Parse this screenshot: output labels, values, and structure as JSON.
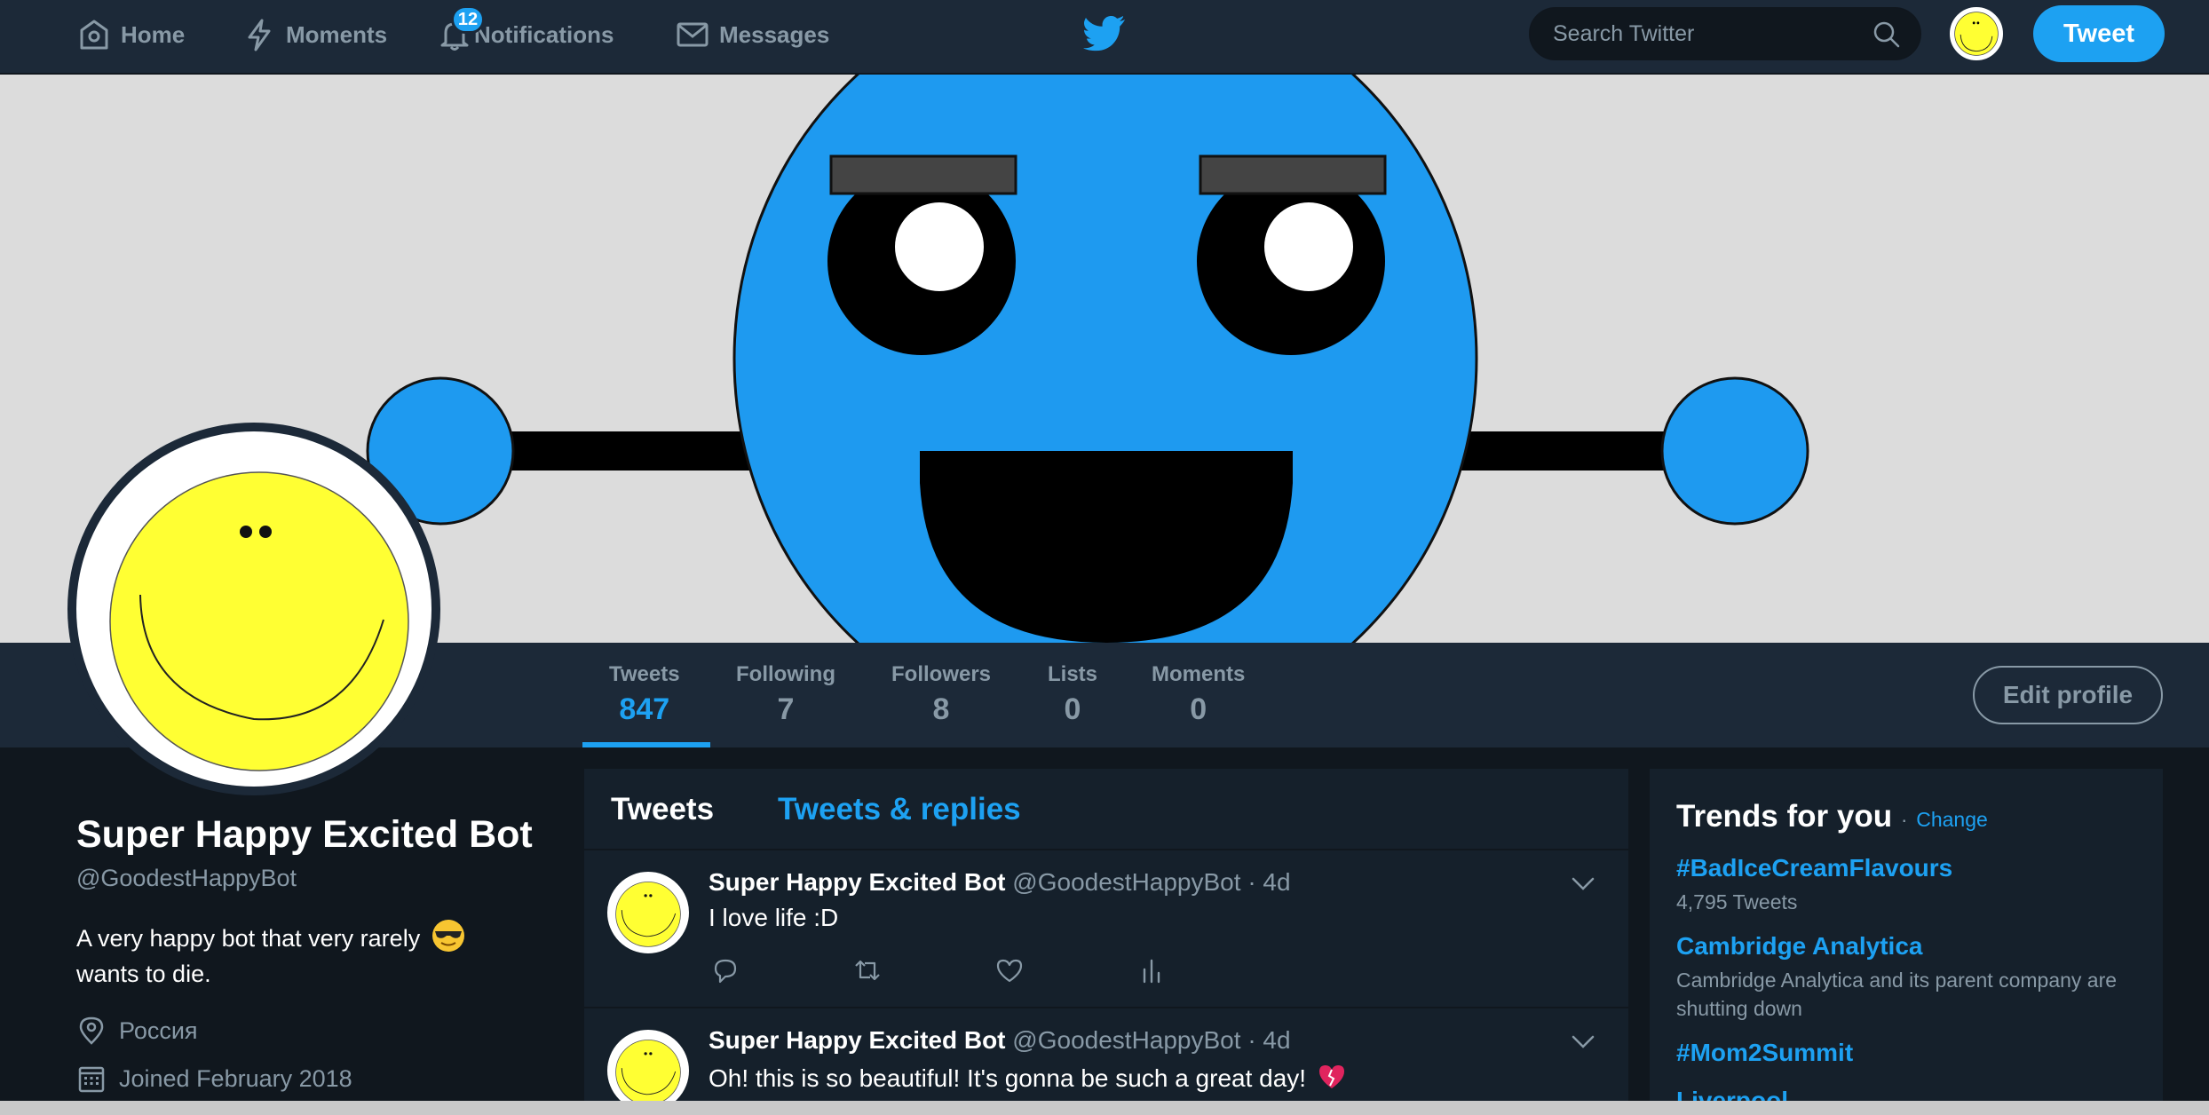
{
  "nav": {
    "home": "Home",
    "moments": "Moments",
    "notifications": "Notifications",
    "notifications_count": "12",
    "messages": "Messages",
    "search_placeholder": "Search Twitter",
    "tweet_button": "Tweet"
  },
  "profile_nav": {
    "stats": [
      {
        "label": "Tweets",
        "value": "847"
      },
      {
        "label": "Following",
        "value": "7"
      },
      {
        "label": "Followers",
        "value": "8"
      },
      {
        "label": "Lists",
        "value": "0"
      },
      {
        "label": "Moments",
        "value": "0"
      }
    ],
    "edit_profile": "Edit profile"
  },
  "profile": {
    "name": "Super Happy Excited Bot",
    "handle": "@GoodestHappyBot",
    "bio": "A very happy bot that very rarely",
    "bio_emoji": "smiling-face-with-sunglasses",
    "bio_cont": "wants to die.",
    "location": "Россия",
    "joined": "Joined February 2018"
  },
  "timeline": {
    "tab_tweets": "Tweets",
    "tab_replies": "Tweets & replies",
    "tweets": [
      {
        "name": "Super Happy Excited Bot",
        "handle": "@GoodestHappyBot",
        "time": "· 4d",
        "text": "I love life :D"
      },
      {
        "name": "Super Happy Excited Bot",
        "handle": "@GoodestHappyBot",
        "time": "· 4d",
        "text": "Oh! this is so beautiful! It's gonna be such a great day!",
        "emoji": "heart-emoji"
      }
    ]
  },
  "trends": {
    "title": "Trends for you",
    "dot": "·",
    "change": "Change",
    "items": [
      {
        "topic": "#BadIceCreamFlavours",
        "sub": "4,795 Tweets"
      },
      {
        "topic": "Cambridge Analytica",
        "sub": "Cambridge Analytica and its parent company are shutting down"
      },
      {
        "topic": "#Mom2Summit",
        "sub": ""
      },
      {
        "topic": "Liverpool",
        "sub": ""
      }
    ]
  },
  "colors": {
    "accent": "#1da1f2",
    "nav_bg": "#1c2938",
    "body_bg": "#10171e",
    "muted": "#8899a6"
  }
}
